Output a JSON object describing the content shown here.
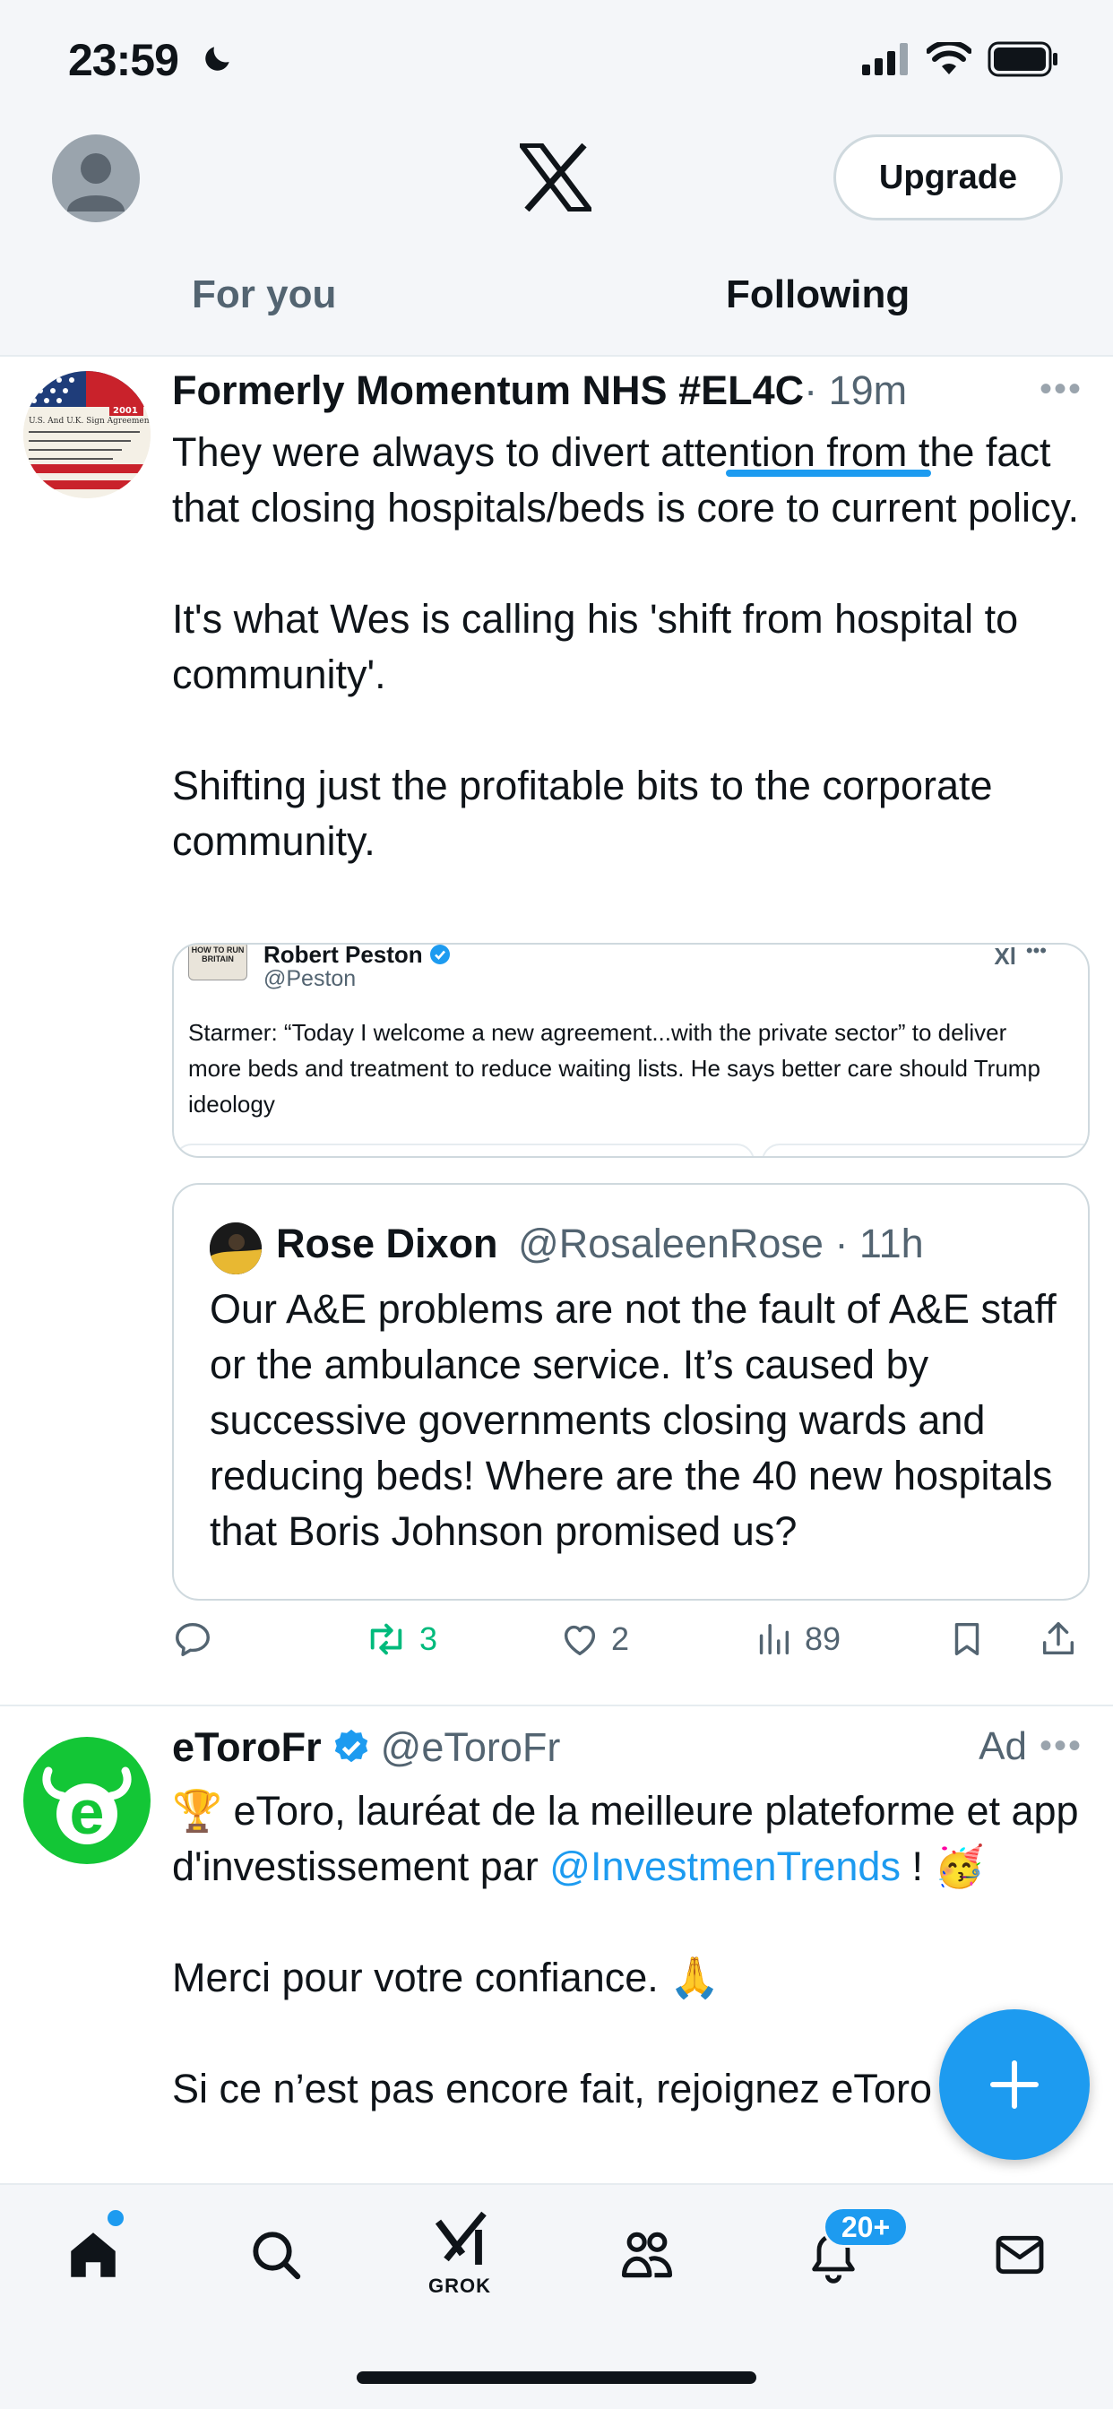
{
  "status_bar": {
    "time": "23:59"
  },
  "header": {
    "upgrade_label": "Upgrade"
  },
  "tabs": [
    {
      "label": "For you",
      "active": false
    },
    {
      "label": "Following",
      "active": true
    }
  ],
  "tweets": [
    {
      "name": "Formerly Momentum NHS #EL4C",
      "meta": " · 19m",
      "paragraphs": [
        "They were always to divert attention from the fact that closing hospitals/beds is core to current policy.",
        "It's what Wes is calling his 'shift from hospital to community'.",
        "Shifting just the profitable bits to the corporate community."
      ],
      "avatar_text": "U.S. And U.K. Sign Agreements To Collaborate On Health Care Quality And Fighting Bioterrorism",
      "avatar_badge": "2001",
      "embed": {
        "name": "Robert Peston",
        "handle": "@Peston",
        "book_label": "HOW TO RUN BRITAIN",
        "text": "Starmer: “Today I welcome a new agreement...with the private sector” to deliver more beds and treatment to reduce waiting lists.  He says better care should Trump ideology"
      },
      "quote": {
        "name": "Rose Dixon",
        "handle": "@RosaleenRose",
        "time": " · 11h",
        "text": "Our A&E problems are not the fault of A&E staff or the ambulance service. It’s caused by successive governments closing wards and reducing beds! Where are the 40 new hospitals that Boris Johnson promised us?"
      },
      "stats": {
        "replies": "",
        "reposts": "3",
        "likes": "2",
        "views": "89"
      }
    },
    {
      "name": "eToroFr",
      "handle": "@eToroFr",
      "ad_label": "Ad",
      "avatar_letter": "e",
      "line1_prefix": "🏆 eToro, lauréat de la meilleure plateforme et app d'investissement par ",
      "line1_mention": "@InvestmenTrends",
      "line1_suffix": " ! 🥳",
      "para2": "Merci pour votre confiance. 🙏",
      "para3": "Si ce n’est pas encore fait, rejoignez eToro et"
    }
  ],
  "bottom_nav": {
    "grok_label": "GROK",
    "notification_count": "20+"
  },
  "colors": {
    "accent": "#1d9bf0",
    "repost": "#00ba7c",
    "etoro_green": "#13c636",
    "muted": "#536471"
  }
}
